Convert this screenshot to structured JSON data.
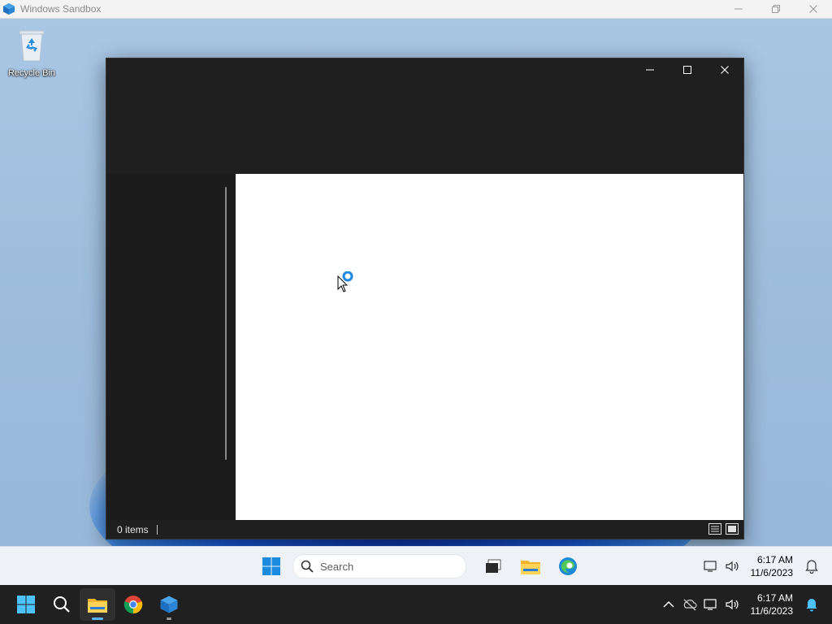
{
  "host_window": {
    "title": "Windows Sandbox",
    "minimize_icon": "minimize-icon",
    "restore_icon": "restore-icon",
    "close_icon": "close-icon"
  },
  "desktop": {
    "icons": [
      {
        "label": "Recycle Bin",
        "icon": "recycle-bin-icon"
      }
    ]
  },
  "explorer_window": {
    "status": {
      "item_count": "0 items"
    },
    "loading_indicator": "busy-cursor-icon",
    "view_modes": [
      "details-view-icon",
      "large-icons-view-icon"
    ]
  },
  "sandbox_taskbar": {
    "search_placeholder": "Search",
    "pinned_apps": [
      "start-icon",
      "task-view-icon",
      "file-explorer-icon",
      "edge-icon"
    ],
    "tray_icons": [
      "network-icon",
      "volume-icon",
      "notification-icon"
    ],
    "time": "6:17 AM",
    "date": "11/6/2023"
  },
  "host_taskbar": {
    "apps": [
      "start-icon",
      "search-icon",
      "file-explorer-icon",
      "chrome-icon",
      "windows-sandbox-icon"
    ],
    "active_app": "file-explorer-icon",
    "tray_icons": [
      "chevron-up-icon",
      "onedrive-icon",
      "network-icon",
      "volume-icon",
      "notification-icon"
    ],
    "time": "6:17 AM",
    "date": "11/6/2023"
  },
  "colors": {
    "accent": "#0078d4",
    "host_taskbar_bg": "#202020",
    "explorer_bg": "#1f1f1f",
    "content_bg": "#ffffff"
  }
}
